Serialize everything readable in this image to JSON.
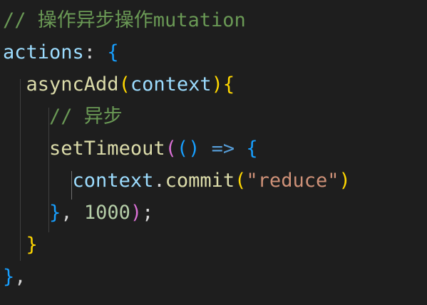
{
  "code_lines": [
    {
      "tokens": [
        {
          "text": "// 操作异步操作mutation",
          "class": "c-comment"
        }
      ]
    },
    {
      "tokens": [
        {
          "text": "actions",
          "class": "c-prop"
        },
        {
          "text": ": ",
          "class": "c-punc"
        },
        {
          "text": "{",
          "class": "c-b3"
        }
      ]
    },
    {
      "tokens": [
        {
          "text": "  ",
          "class": "c-punc"
        },
        {
          "text": "asyncAdd",
          "class": "c-func"
        },
        {
          "text": "(",
          "class": "c-b1"
        },
        {
          "text": "context",
          "class": "c-prop"
        },
        {
          "text": ")",
          "class": "c-b1"
        },
        {
          "text": "{",
          "class": "c-b1"
        }
      ]
    },
    {
      "tokens": [
        {
          "text": "    ",
          "class": "c-punc"
        },
        {
          "text": "// 异步",
          "class": "c-comment"
        }
      ]
    },
    {
      "tokens": [
        {
          "text": "    ",
          "class": "c-punc"
        },
        {
          "text": "setTimeout",
          "class": "c-func"
        },
        {
          "text": "(",
          "class": "c-b2"
        },
        {
          "text": "()",
          "class": "c-b3"
        },
        {
          "text": " ",
          "class": "c-punc"
        },
        {
          "text": "=>",
          "class": "c-op"
        },
        {
          "text": " ",
          "class": "c-punc"
        },
        {
          "text": "{",
          "class": "c-b3"
        }
      ]
    },
    {
      "tokens": [
        {
          "text": "      ",
          "class": "c-punc"
        },
        {
          "text": "context",
          "class": "c-prop"
        },
        {
          "text": ".",
          "class": "c-punc"
        },
        {
          "text": "commit",
          "class": "c-func"
        },
        {
          "text": "(",
          "class": "c-b1"
        },
        {
          "text": "\"reduce\"",
          "class": "c-str"
        },
        {
          "text": ")",
          "class": "c-b1"
        }
      ]
    },
    {
      "tokens": [
        {
          "text": "    ",
          "class": "c-punc"
        },
        {
          "text": "}",
          "class": "c-b3"
        },
        {
          "text": ", ",
          "class": "c-punc"
        },
        {
          "text": "1000",
          "class": "c-num"
        },
        {
          "text": ")",
          "class": "c-b2"
        },
        {
          "text": ";",
          "class": "c-punc"
        }
      ]
    },
    {
      "tokens": [
        {
          "text": "  ",
          "class": "c-punc"
        },
        {
          "text": "}",
          "class": "c-b1"
        }
      ]
    },
    {
      "tokens": [
        {
          "text": "}",
          "class": "c-b3"
        },
        {
          "text": ",",
          "class": "c-punc"
        }
      ]
    }
  ],
  "colors": {
    "background": "#1e1e1e",
    "comment": "#6a9955",
    "property": "#9cdcfe",
    "function": "#dcdcaa",
    "string": "#ce9178",
    "number": "#b5cea8",
    "bracket_level_1": "#ffd700",
    "bracket_level_2": "#da70d6",
    "bracket_level_3": "#179fff"
  }
}
